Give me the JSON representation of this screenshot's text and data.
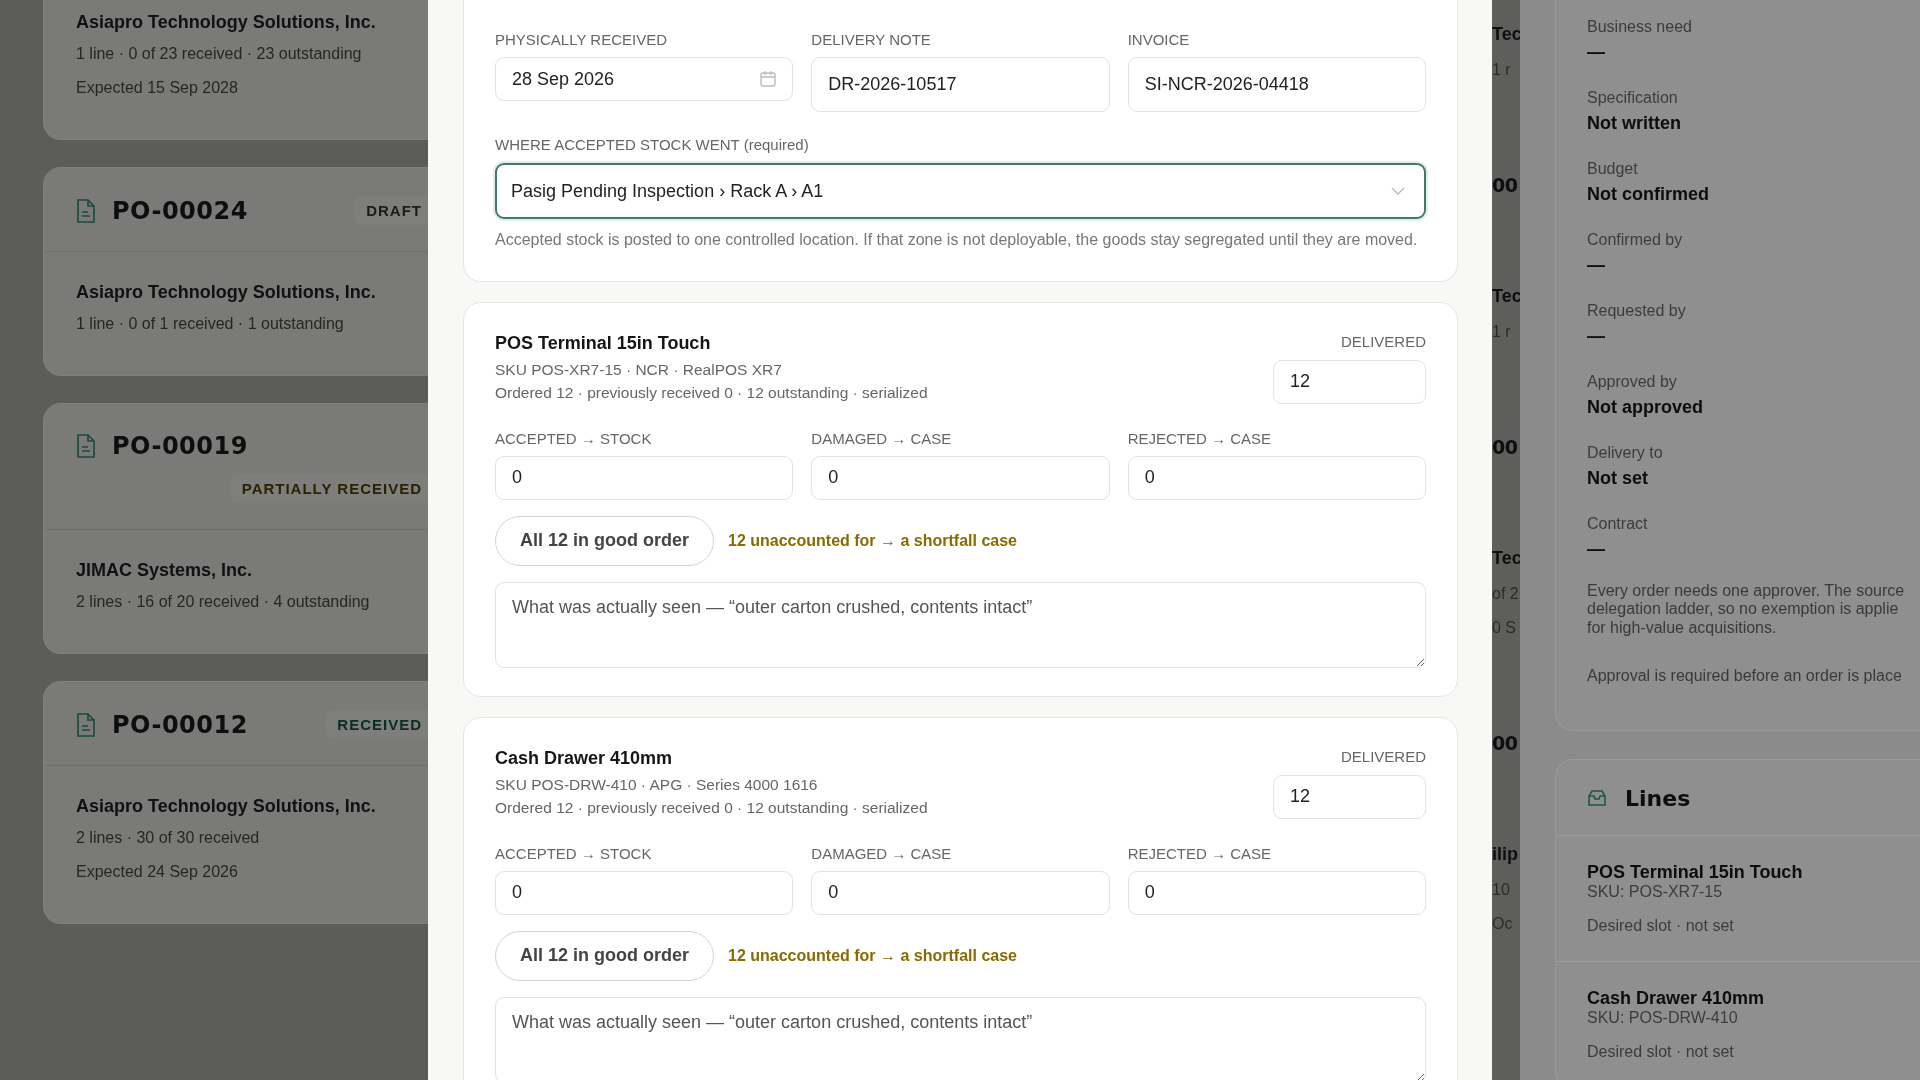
{
  "background_orders": [
    {
      "supplier": "Asiapro Technology Solutions, Inc.",
      "meta": [
        "1 line · 0 of 23 received · 23 outstanding",
        "Expected 15 Sep 2028"
      ]
    },
    {
      "number": "PO-00024",
      "status": {
        "label": "DRAFT",
        "color": "#1c1c1b"
      },
      "supplier": "Asiapro Technology Solutions, Inc.",
      "meta": [
        "1 line · 0 of 1 received · 1 outstanding"
      ]
    },
    {
      "number": "PO-00019",
      "status": {
        "label": "PARTIALLY RECEIVED",
        "color": "#2a2200"
      },
      "supplier": "JIMAC Systems, Inc.",
      "meta": [
        "2 lines · 16 of 20 received · 4 outstanding"
      ]
    },
    {
      "number": "PO-00012",
      "status": {
        "label": "RECEIVED",
        "color": "#0a2e21"
      },
      "supplier": "Asiapro Technology Solutions, Inc.",
      "meta": [
        "2 lines · 30 of 30 received",
        "Expected 24 Sep 2026"
      ]
    }
  ],
  "middle_fragments": [
    {
      "kind": "name",
      "text": "Tec"
    },
    {
      "kind": "meta",
      "text": "1 r"
    },
    {
      "kind": "heading",
      "text": "00"
    },
    {
      "kind": "name",
      "text": "Tec"
    },
    {
      "kind": "meta",
      "text": "1 r"
    },
    {
      "kind": "heading",
      "text": "00"
    },
    {
      "kind": "name",
      "text": "Tec"
    },
    {
      "kind": "meta",
      "text": "of 2"
    },
    {
      "kind": "meta",
      "text": "0 S"
    },
    {
      "kind": "heading",
      "text": "00"
    },
    {
      "kind": "name",
      "text": "ilip"
    },
    {
      "kind": "meta",
      "text": "10"
    },
    {
      "kind": "meta",
      "text": "Oc"
    }
  ],
  "receipt": {
    "fields": [
      {
        "label": "PHYSICALLY RECEIVED",
        "value": "28 Sep 2026",
        "kind": "date"
      },
      {
        "label": "DELIVERY NOTE",
        "value": "DR-2026-10517",
        "kind": "text"
      },
      {
        "label": "INVOICE",
        "value": "SI-NCR-2026-04418",
        "kind": "text"
      }
    ],
    "location": {
      "label": "WHERE ACCEPTED STOCK WENT (required)",
      "value": "Pasig Pending Inspection › Rack A › A1",
      "focused": true,
      "help": "Accepted stock is posted to one controlled location. If that zone is not deployable, the goods stay segregated until they are moved."
    }
  },
  "lines": [
    {
      "name": "POS Terminal 15in Touch",
      "sku": "SKU POS-XR7-15 · NCR · RealPOS XR7",
      "ordered": "Ordered 12 · previously received 0 · 12 outstanding · serialized",
      "delivered_label": "DELIVERED",
      "delivered": "12",
      "splits": [
        {
          "label": "ACCEPTED → STOCK",
          "value": "0"
        },
        {
          "label": "DAMAGED → CASE",
          "value": "0"
        },
        {
          "label": "REJECTED → CASE",
          "value": "0"
        }
      ],
      "action": "All 12 in good order",
      "warning": "12 unaccounted for → a shortfall case",
      "note_placeholder": "What was actually seen — “outer carton crushed, contents intact”"
    },
    {
      "name": "Cash Drawer 410mm",
      "sku": "SKU POS-DRW-410 · APG · Series 4000 1616",
      "ordered": "Ordered 12 · previously received 0 · 12 outstanding · serialized",
      "delivered_label": "DELIVERED",
      "delivered": "12",
      "splits": [
        {
          "label": "ACCEPTED → STOCK",
          "value": "0"
        },
        {
          "label": "DAMAGED → CASE",
          "value": "0"
        },
        {
          "label": "REJECTED → CASE",
          "value": "0"
        }
      ],
      "action": "All 12 in good order",
      "warning": "12 unaccounted for → a shortfall case",
      "note_placeholder": "What was actually seen — “outer carton crushed, contents intact”"
    }
  ],
  "details": {
    "items": [
      {
        "label": "Business need",
        "value": "—"
      },
      {
        "label": "Specification",
        "value": "Not written"
      },
      {
        "label": "Budget",
        "value": "Not confirmed"
      },
      {
        "label": "Confirmed by",
        "value": "—"
      },
      {
        "label": "Requested by",
        "value": "—"
      },
      {
        "label": "Approved by",
        "value": "Not approved"
      },
      {
        "label": "Delivery to",
        "value": "Not set"
      },
      {
        "label": "Contract",
        "value": "—"
      }
    ],
    "note_lines": [
      "Every order needs one approver. The source",
      "delegation ladder, so no exemption is applie",
      "for high-value acquisitions."
    ],
    "footer": "Approval is required before an order is place"
  },
  "lines_panel": {
    "title": "Lines",
    "items": [
      {
        "name": "POS Terminal 15in Touch",
        "sku": "SKU: POS-XR7-15",
        "slot": "Desired slot · not set"
      },
      {
        "name": "Cash Drawer 410mm",
        "sku": "SKU: POS-DRW-410",
        "slot": "Desired slot · not set"
      }
    ]
  }
}
